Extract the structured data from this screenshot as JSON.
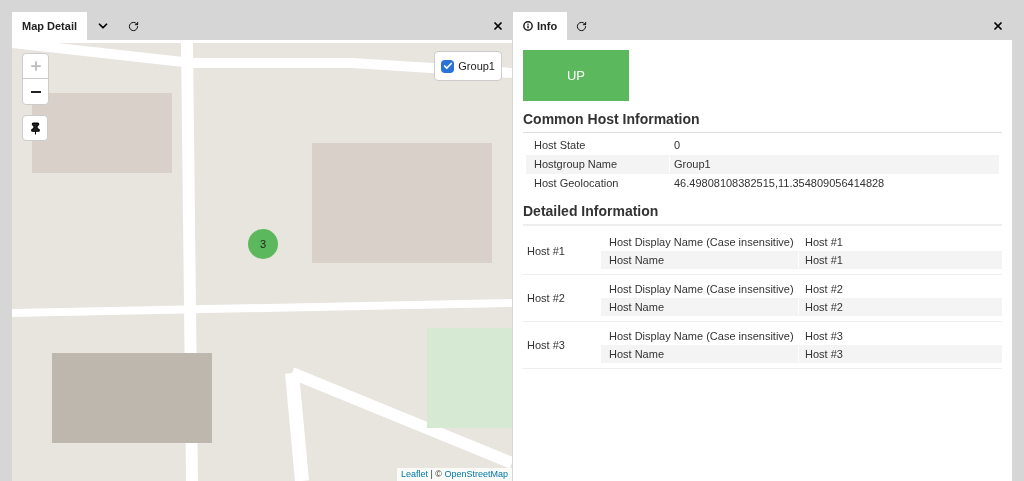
{
  "map_panel": {
    "tabs": [
      {
        "label": "Map Detail",
        "selected": true
      }
    ],
    "layer_control": {
      "label": "Group1",
      "checked": true
    },
    "cluster": {
      "count": "3"
    },
    "attribution": {
      "link": "Leaflet",
      "separator": " | © ",
      "source": "OpenStreetMap"
    }
  },
  "info_panel": {
    "tabs": [
      {
        "label": "Info",
        "selected": true
      }
    ],
    "status": {
      "label": "UP",
      "color": "#5cb85c"
    },
    "common_title": "Common Host Information",
    "common_rows": [
      {
        "label": "Host State",
        "value": "0"
      },
      {
        "label": "Hostgroup Name",
        "value": "Group1"
      },
      {
        "label": "Host Geolocation",
        "value": "46.49808108382515,11.354809056414828"
      }
    ],
    "detailed_title": "Detailed Information",
    "hosts": [
      {
        "name": "Host #1",
        "fields": [
          {
            "label": "Host Display Name (Case insensitive)",
            "value": "Host #1"
          },
          {
            "label": "Host Name",
            "value": "Host #1"
          }
        ]
      },
      {
        "name": "Host #2",
        "fields": [
          {
            "label": "Host Display Name (Case insensitive)",
            "value": "Host #2"
          },
          {
            "label": "Host Name",
            "value": "Host #2"
          }
        ]
      },
      {
        "name": "Host #3",
        "fields": [
          {
            "label": "Host Display Name (Case insensitive)",
            "value": "Host #3"
          },
          {
            "label": "Host Name",
            "value": "Host #3"
          }
        ]
      }
    ]
  }
}
